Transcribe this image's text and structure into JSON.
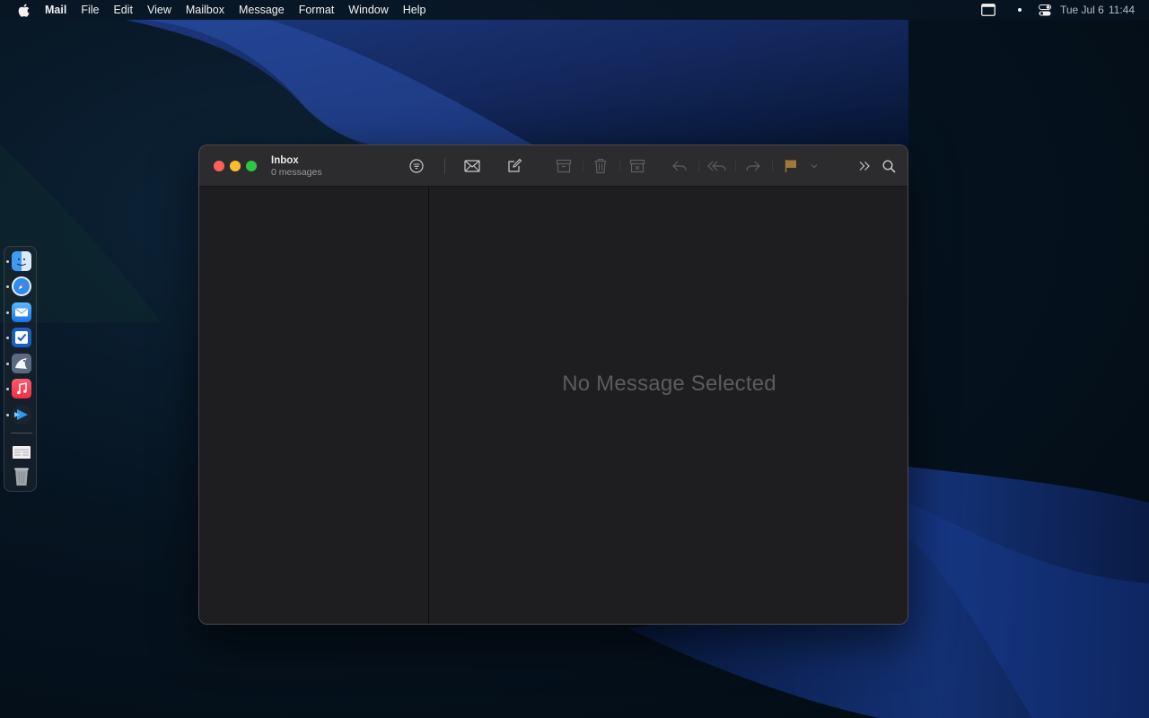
{
  "menubar": {
    "app_name": "Mail",
    "items": [
      "File",
      "Edit",
      "View",
      "Mailbox",
      "Message",
      "Format",
      "Window",
      "Help"
    ],
    "clock": {
      "date": "Tue Jul 6",
      "time": "11:44"
    }
  },
  "window": {
    "title": "Inbox",
    "subtitle": "0 messages",
    "empty_state": "No Message Selected"
  },
  "toolbar": {
    "buttons": [
      "filter-icon",
      "get-mail-icon",
      "compose-icon",
      "archive-icon",
      "trash-icon",
      "junk-icon",
      "reply-icon",
      "reply-all-icon",
      "forward-icon",
      "flag-icon",
      "flag-menu-chevron-icon",
      "more-icon",
      "search-icon"
    ],
    "flag_color": "#a2773a"
  },
  "dock": {
    "apps": [
      "Finder",
      "Safari",
      "Mail",
      "Reminders",
      "Preview",
      "Music",
      "Infuse",
      "Downloads",
      "Trash"
    ]
  },
  "colors": {
    "window_bg": "#1e1e20",
    "titlebar_bg": "#2c2c2e",
    "traffic_close": "#ff5f57",
    "traffic_min": "#febc2e",
    "traffic_max": "#28c840"
  }
}
